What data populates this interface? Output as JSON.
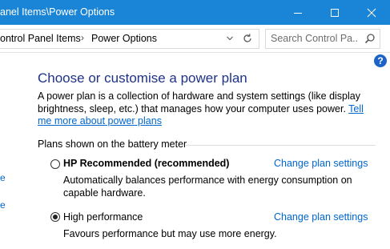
{
  "window": {
    "title": "anel Items\\Power Options"
  },
  "address_bar": {
    "crumbs": [
      "ontrol Panel Items",
      "Power Options"
    ]
  },
  "search": {
    "placeholder": "Search Control Pa..."
  },
  "help": {
    "label": "?"
  },
  "left_panel": {
    "links": [
      "e",
      "e"
    ]
  },
  "main": {
    "heading": "Choose or customise a power plan",
    "description_text": "A power plan is a collection of hardware and system settings (like display brightness, sleep, etc.) that manages how your computer uses power. ",
    "description_link": "Tell me more about power plans",
    "group_header": "Plans shown on the battery meter",
    "plans": [
      {
        "name": "HP Recommended (recommended)",
        "description": "Automatically balances performance with energy consumption on capable hardware.",
        "selected": false,
        "change_label": "Change plan settings"
      },
      {
        "name": "High performance",
        "description": "Favours performance but may use more energy.",
        "selected": true,
        "change_label": "Change plan settings"
      }
    ]
  },
  "colors": {
    "titlebar": "#1a84d6",
    "heading": "#1e3287",
    "link": "#0066cc"
  }
}
